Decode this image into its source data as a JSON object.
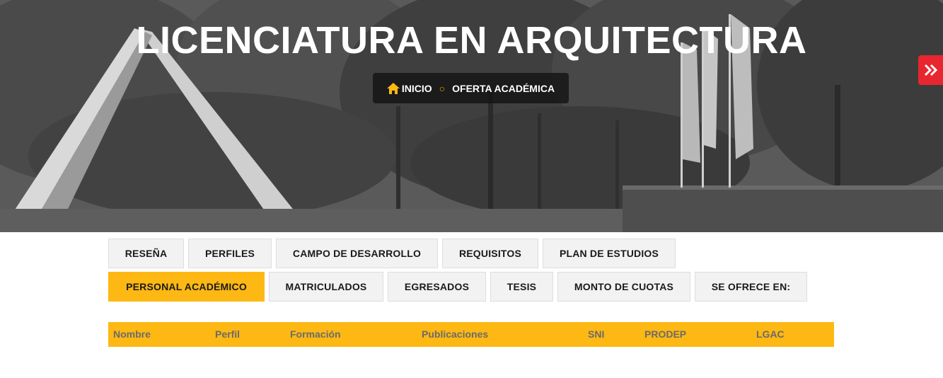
{
  "hero": {
    "title": "LICENCIATURA EN ARQUITECTURA",
    "breadcrumb": {
      "home": "INICIO",
      "separator": "○",
      "current": "OFERTA ACADÉMICA"
    }
  },
  "tabs": {
    "row1": [
      "RESEÑA",
      "PERFILES",
      "CAMPO DE DESARROLLO",
      "REQUISITOS",
      "PLAN DE ESTUDIOS"
    ],
    "row2": [
      "PERSONAL ACADÉMICO",
      "MATRICULADOS",
      "EGRESADOS",
      "TESIS",
      "MONTO DE CUOTAS",
      "SE OFRECE EN:"
    ],
    "active": "PERSONAL ACADÉMICO"
  },
  "table": {
    "headers": [
      "Nombre",
      "Perfil",
      "Formación",
      "Publicaciones",
      "SNI",
      "PRODEP",
      "LGAC"
    ]
  },
  "colors": {
    "accent": "#fdb813",
    "side_button": "#e8262f",
    "breadcrumb_bg": "#141414"
  },
  "icons": {
    "home": "home-icon",
    "side": "double-chevron-right-icon"
  }
}
